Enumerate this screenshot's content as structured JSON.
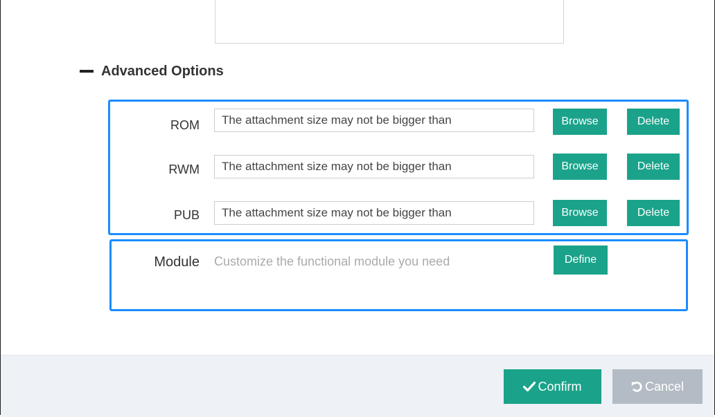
{
  "advanced": {
    "title": "Advanced Options",
    "toggle_icon": "minus-icon"
  },
  "files": [
    {
      "label": "ROM",
      "placeholder": "The attachment size may not be bigger than",
      "browse_label": "Browse",
      "delete_label": "Delete"
    },
    {
      "label": "RWM",
      "placeholder": "The attachment size may not be bigger than",
      "browse_label": "Browse",
      "delete_label": "Delete"
    },
    {
      "label": "PUB",
      "placeholder": "The attachment size may not be bigger than",
      "browse_label": "Browse",
      "delete_label": "Delete"
    }
  ],
  "module": {
    "label": "Module",
    "hint": "Customize the functional module you need",
    "define_label": "Define"
  },
  "footer": {
    "confirm_label": "Confirm",
    "confirm_icon": "checkmark-icon",
    "cancel_label": "Cancel",
    "cancel_icon": "undo-icon"
  },
  "colors": {
    "accent": "#1aa38a",
    "group_border": "#1a8cff",
    "cancel_bg": "#b3bcc4",
    "footer_bg": "#eef1f5"
  }
}
